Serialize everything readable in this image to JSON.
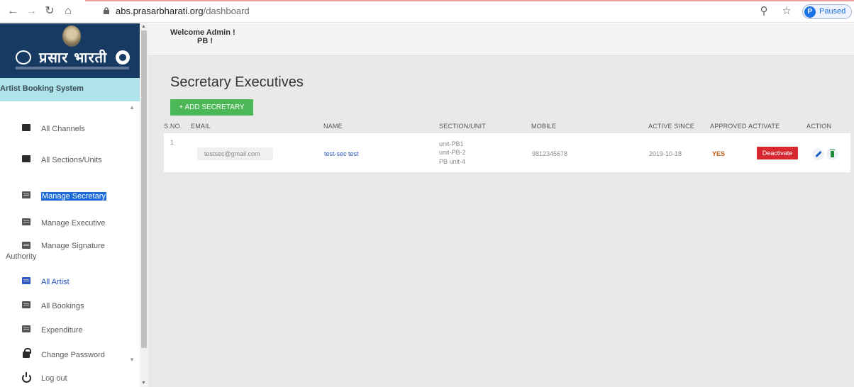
{
  "browser": {
    "url_host": "abs.prasarbharati.org",
    "url_path": "/dashboard",
    "profile_initial": "P",
    "profile_status": "Paused"
  },
  "sidebar": {
    "logo_text": "प्रसार भारती",
    "system_title": "Artist Booking System",
    "items": [
      {
        "label": "All Channels",
        "icon": "document-icon"
      },
      {
        "label": "All Sections/Units",
        "icon": "document-icon"
      },
      {
        "label": "Manage Secretary",
        "icon": "table-icon"
      },
      {
        "label": "Manage Executive",
        "icon": "table-icon"
      },
      {
        "label": "Manage Signature",
        "label2": "Authority",
        "icon": "table-icon"
      },
      {
        "label": "All Artist",
        "icon": "table-icon"
      },
      {
        "label": "All Bookings",
        "icon": "table-icon"
      },
      {
        "label": "Expenditure",
        "icon": "table-icon"
      },
      {
        "label": "Change Password",
        "icon": "lock-icon"
      },
      {
        "label": "Log out",
        "icon": "power-icon"
      }
    ]
  },
  "header": {
    "welcome": "Welcome Admin !",
    "welcome_sub": "PB !"
  },
  "main": {
    "title": "Secretary Executives",
    "add_button": "+ ADD SECRETARY",
    "columns": [
      "S.NO.",
      "EMAIL",
      "NAME",
      "SECTION/UNIT",
      "MOBILE",
      "ACTIVE SINCE",
      "APPROVED",
      "ACTIVATE",
      "ACTION"
    ],
    "rows": [
      {
        "sno": "1",
        "email": "testsec@gmail.com",
        "name": "test-sec test",
        "sections": [
          "unit-PB1",
          "unit-PB-2",
          "PB unit-4"
        ],
        "mobile": "9812345678",
        "active_since": "2019-10-18",
        "approved": "YES",
        "activate": "Deactivate"
      }
    ]
  },
  "colors": {
    "sidebar_logo_bg": "#173a63",
    "system_bar_bg": "#aee3ea",
    "add_button_bg": "#4cb757",
    "deactivate_bg": "#d9272f",
    "highlight": "#1a6ad8"
  }
}
